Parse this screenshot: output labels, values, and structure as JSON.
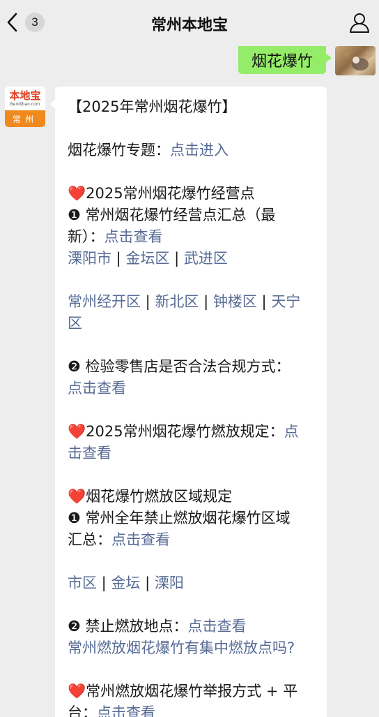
{
  "navbar": {
    "badge_count": "3",
    "title": "常州本地宝"
  },
  "user_message": {
    "text": "烟花爆竹"
  },
  "bot": {
    "logo_text": "本地宝",
    "logo_sub": "Bendibao.com",
    "logo_city": "常州"
  },
  "message": {
    "title": "【2025年常州烟花爆竹】",
    "topic_label": "烟花爆竹专题：",
    "topic_link": "点击进入",
    "s1_heart": "❤️",
    "s1_title": "2025常州烟花爆竹经营点",
    "s1_item1_a": "❶ 常州烟花爆竹经营点汇总（最",
    "s1_item1_b": "新）：",
    "s1_item1_link": "点击查看",
    "s1_areas_row1": [
      "溧阳市",
      "金坛区",
      "武进区"
    ],
    "s1_areas_row2": [
      "常州经开区",
      "新北区",
      "钟楼区",
      "天宁"
    ],
    "s1_areas_row3": "区",
    "s1_item2": "❷ 检验零售店是否合法合规方式：",
    "s1_item2_link": "点击查看",
    "s2_heart": "❤️",
    "s2_title": "2025常州烟花爆竹燃放规定：",
    "s2_link_a": "点",
    "s2_link_b": "击查看",
    "s3_heart": "❤️",
    "s3_title": "烟花爆竹燃放区域规定",
    "s3_item1_a": "❶ 常州全年禁止燃放烟花爆竹区域",
    "s3_item1_b": "汇总：",
    "s3_item1_link": "点击查看",
    "s3_areas": [
      "市区",
      "金坛",
      "溧阳"
    ],
    "s3_item2": "❷ 禁止燃放地点：",
    "s3_item2_link": "点击查看",
    "s3_question_link": "常州燃放烟花爆竹有集中燃放点吗?",
    "s4_heart": "❤️",
    "s4_title": "常州燃放烟花爆竹举报方式 + 平",
    "s4_tail": "台：",
    "s4_link": "点击查看"
  },
  "colors": {
    "link": "#576b95",
    "user_bubble": "#95ec69",
    "background": "#ededed"
  }
}
